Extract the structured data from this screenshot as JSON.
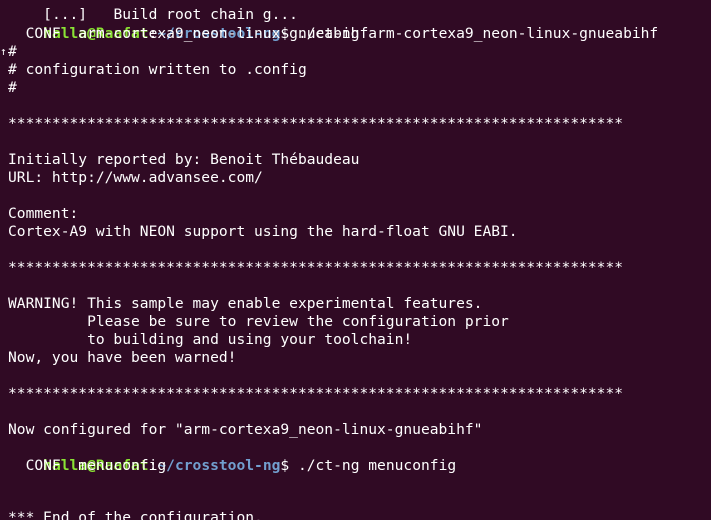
{
  "terminal": {
    "partial_top_line": "[...]   Build root chain g...",
    "user_host": "halla@Raafat",
    "colon": ":",
    "cwd": "~/crosstool-ng",
    "prompt_symbol": "$ ",
    "cmd1": "./ct-ng arm-cortexa9_neon-linux-gnueabihf",
    "conf1": "  CONF  arm-cortexa9_neon-linux-gnueabihf",
    "hash1": "#",
    "config_written": "# configuration written to .config",
    "hash2": "#",
    "stars1": "**********************************************************************",
    "reported_by": "Initially reported by: Benoit Thébaudeau",
    "url": "URL: http://www.advansee.com/",
    "comment_label": "Comment:",
    "comment_text": "Cortex-A9 with NEON support using the hard-float GNU EABI.",
    "stars2": "**********************************************************************",
    "warning1": "WARNING! This sample may enable experimental features.",
    "warning2": "         Please be sure to review the configuration prior",
    "warning3": "         to building and using your toolchain!",
    "warning4": "Now, you have been warned!",
    "stars3": "**********************************************************************",
    "configured_for": "Now configured for \"arm-cortexa9_neon-linux-gnueabihf\"",
    "cmd2": "./ct-ng menuconfig",
    "conf2": "  CONF  menuconfig",
    "partial_bottom_line": "*** End of the configuration."
  }
}
